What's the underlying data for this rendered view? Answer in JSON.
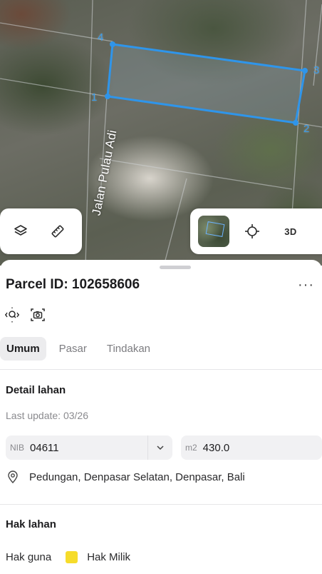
{
  "map": {
    "street_name": "Jalan Pulau Adi",
    "vertices": [
      "1",
      "2",
      "3",
      "4"
    ],
    "parcel_outline_color": "#3a9be8",
    "layers_button": {
      "icon": "layers-icon"
    },
    "measure_button": {
      "icon": "ruler-icon"
    },
    "basemap_button": {
      "icon": "satellite-thumbnail"
    },
    "locate_button": {
      "icon": "crosshair-icon"
    },
    "view_3d_label": "3D"
  },
  "sheet": {
    "title": "Parcel ID: 102658606",
    "more_label": "···",
    "actions": [
      {
        "name": "zoom-to-parcel",
        "icon": "focus-search-icon"
      },
      {
        "name": "screenshot",
        "icon": "camera-icon"
      }
    ],
    "tabs": [
      {
        "label": "Umum",
        "active": true
      },
      {
        "label": "Pasar",
        "active": false
      },
      {
        "label": "Tindakan",
        "active": false
      }
    ],
    "detail": {
      "heading": "Detail lahan",
      "last_update": "Last update: 03/26",
      "nib_prefix": "NIB",
      "nib_value": "04611",
      "area_prefix": "m2",
      "area_value": "430.0",
      "address": "Pedungan, Denpasar Selatan, Denpasar, Bali"
    },
    "rights": {
      "heading": "Hak lahan",
      "label": "Hak guna",
      "value": "Hak Milik",
      "swatch_color": "#f6dc2b"
    }
  }
}
